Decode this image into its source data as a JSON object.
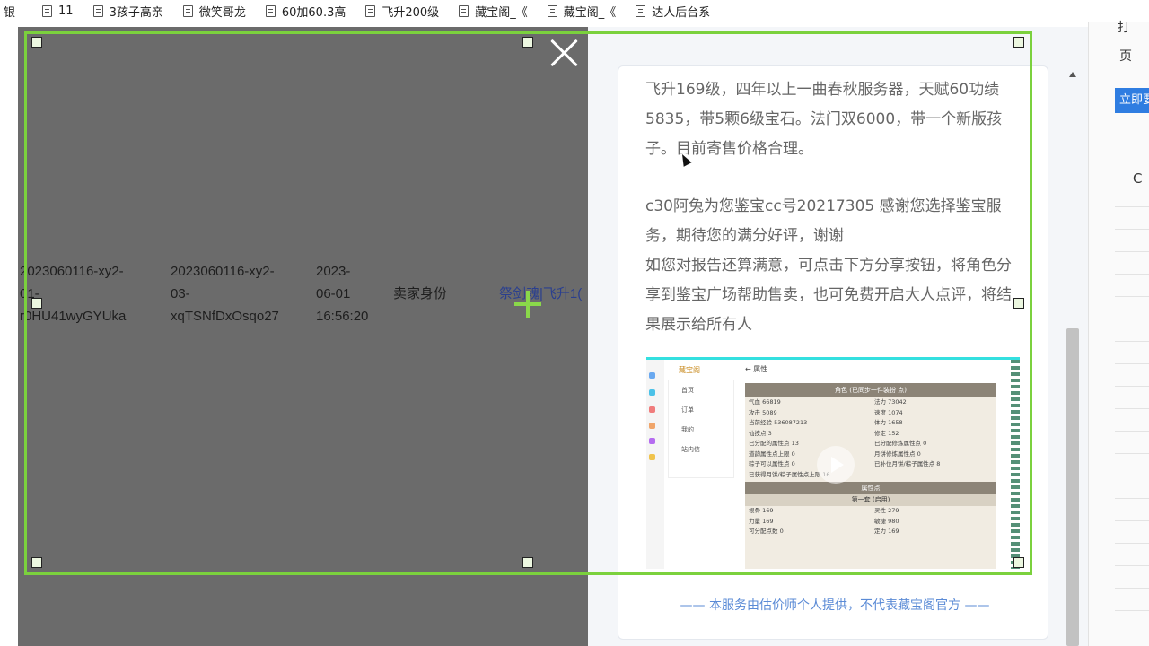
{
  "bookmarks": [
    {
      "label": "银"
    },
    {
      "label": "11"
    },
    {
      "label": "3孩子高亲"
    },
    {
      "label": "微笑哥龙"
    },
    {
      "label": "60加60.3高"
    },
    {
      "label": "飞升200级"
    },
    {
      "label": "藏宝阁_《"
    },
    {
      "label": "藏宝阁_《"
    },
    {
      "label": "达人后台系"
    }
  ],
  "table_row": {
    "col1": [
      "2023060116-xy2-",
      "01-",
      "r0HU41wyGYUka"
    ],
    "col2": [
      "2023060116-xy2-",
      "03-",
      "xqTSNfDxOsqo27"
    ],
    "col3": [
      "2023-",
      "06-01",
      "16:56:20"
    ],
    "col4": "卖家身份",
    "col5": "祭剑魂|飞升1("
  },
  "article": {
    "para1": "飞升169级，四年以上一曲春秋服务器，天赋60功绩5835，带5颗6级宝石。法门双6000，带一个新版孩子。目前寄售价格合理。",
    "para2_line1": "c30阿兔为您鉴宝cc号20217305 感谢您选择鉴宝服务，期待您的满分好评，谢谢",
    "para2_line2": "如您对报告还算满意，可点击下方分享按钮，将角色分享到鉴宝广场帮助售卖，也可免费开启大人点评，将结果展示给所有人",
    "footer": "——  本服务由估价师个人提供，不代表藏宝阁官方  ——"
  },
  "preview": {
    "logo": "藏宝阁",
    "title": "← 属性",
    "menu": [
      "首页",
      "订单",
      "我的",
      "站内信"
    ],
    "header": "角色 (已同步一件装扮 点)",
    "rows": [
      [
        "气血 66819",
        "法力 73042"
      ],
      [
        "攻击 5089",
        "速度 1074"
      ],
      [
        "当前经验 536087213",
        "体力 1658"
      ],
      [
        "仙技点 3",
        "修定 152"
      ],
      [
        "已分配的属性点 13",
        "已分配修炼属性点 0"
      ],
      [
        "道韵属性点上限 0",
        "月饼修炼属性点 0"
      ],
      [
        "粽子可以属性点 0",
        "已补位月饼/粽子属性点 8"
      ],
      [
        "已获得月饼/粽子属性点上限 16",
        ""
      ]
    ],
    "sub_header": "属性点",
    "sub_header2": "第一套 (启用)",
    "rows2": [
      [
        "根骨 169",
        "灵性 279"
      ],
      [
        "力量 169",
        "敏捷 980"
      ],
      [
        "可分配点数 0",
        "定力 169"
      ]
    ]
  },
  "browser_edge": {
    "item1": "打",
    "item2": "页",
    "button": "立即要",
    "letter": "C"
  }
}
